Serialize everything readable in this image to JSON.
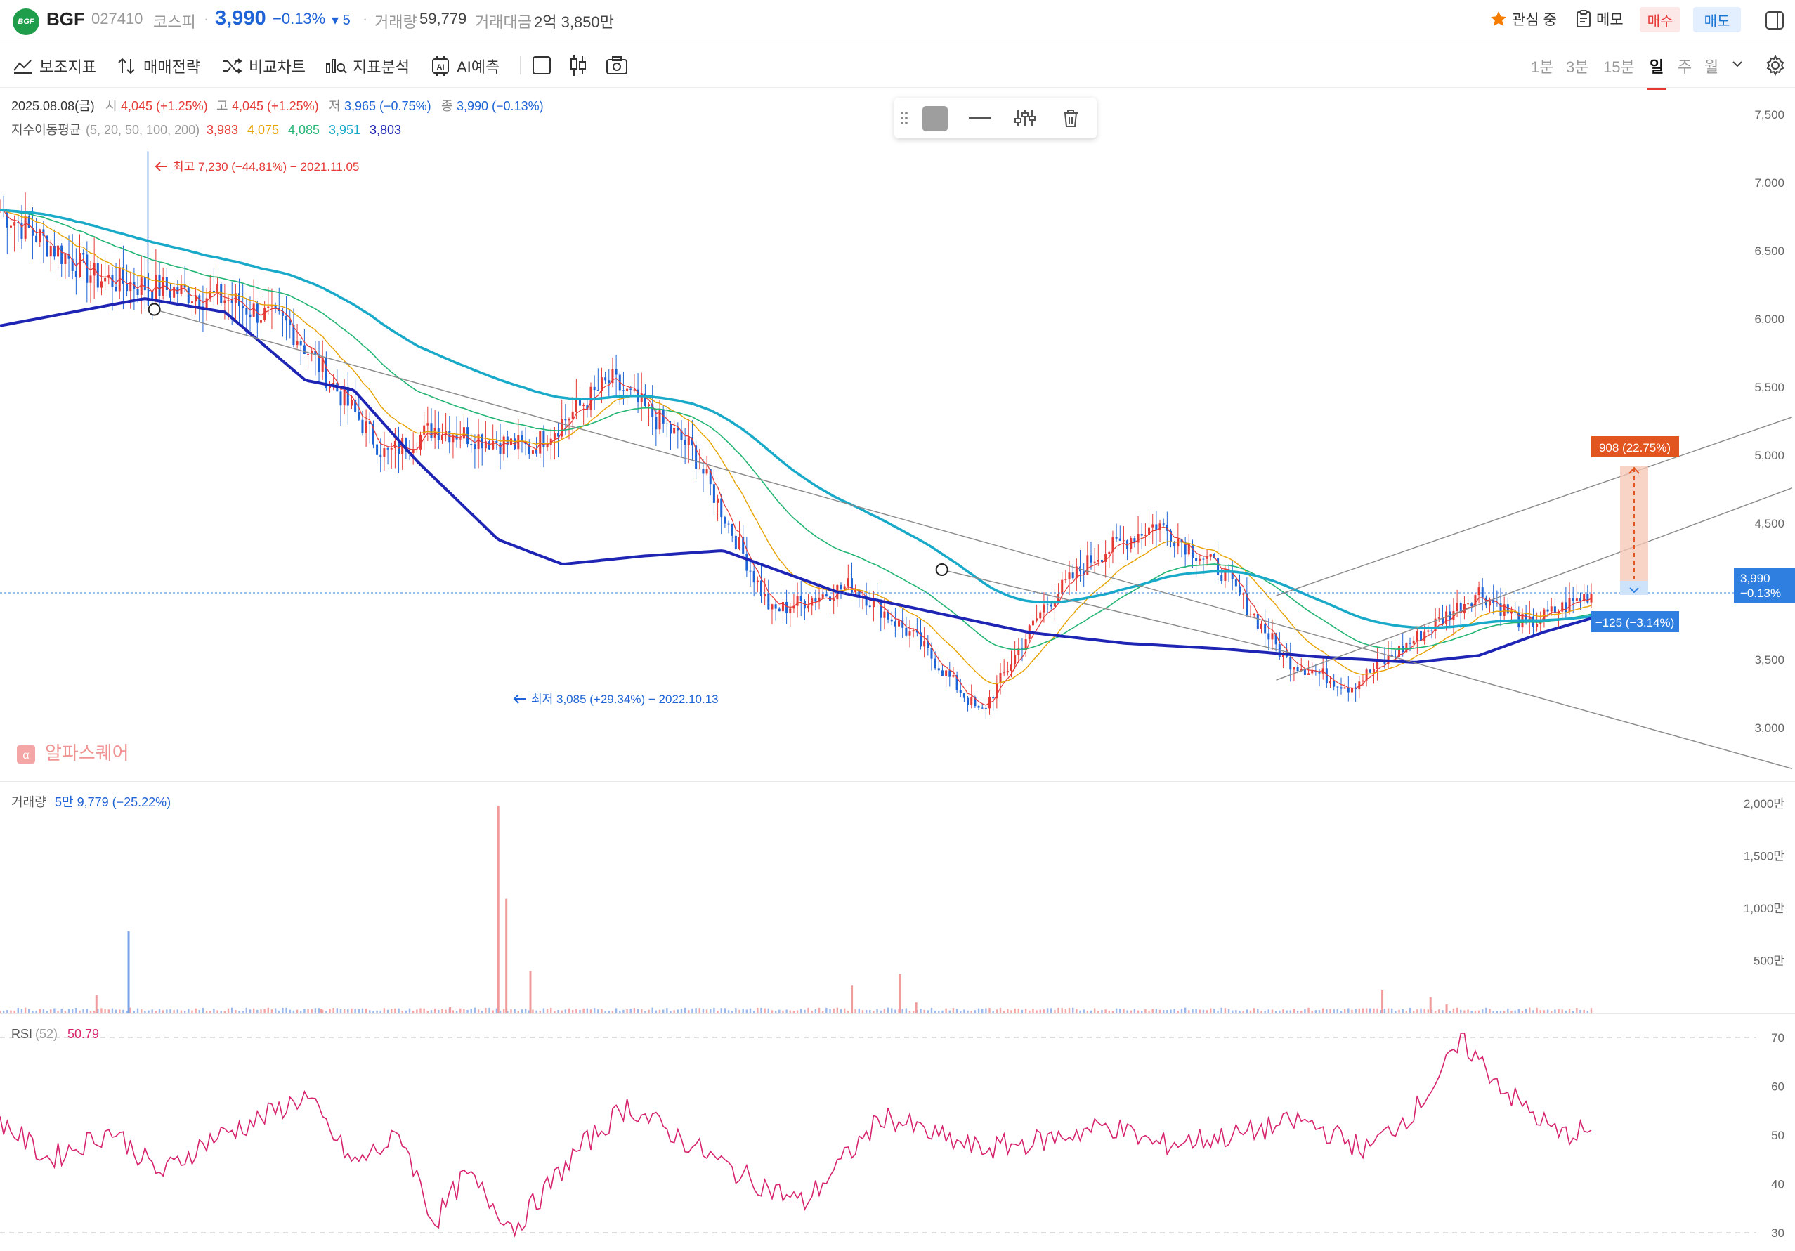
{
  "header": {
    "logo_text": "BGF",
    "name": "BGF",
    "code": "027410",
    "market": "코스피",
    "price": "3,990",
    "change_pct": "−0.13%",
    "change_abs": "▾ 5",
    "volume_label": "거래량",
    "volume": "59,779",
    "amount_label": "거래대금",
    "amount": "2억 3,850만",
    "watch_label": "관심 중",
    "memo_label": "메모",
    "buy_label": "매수",
    "sell_label": "매도"
  },
  "toolbar": {
    "items": [
      "보조지표",
      "매매전략",
      "비교차트",
      "지표분석",
      "AI예측"
    ],
    "timeframes": [
      "1분",
      "3분",
      "15분",
      "일",
      "주",
      "월"
    ],
    "active_timeframe": "일"
  },
  "info": {
    "date": "2025.08.08(금)",
    "open_label": "시",
    "open": "4,045 (+1.25%)",
    "high_label": "고",
    "high": "4,045 (+1.25%)",
    "low_label": "저",
    "low": "3,965 (−0.75%)",
    "close_label": "종",
    "close": "3,990 (−0.13%)",
    "ma_label": "지수이동평균",
    "ma_params": "(5, 20, 50, 100, 200)",
    "ma_values": [
      "3,983",
      "4,075",
      "4,085",
      "3,951",
      "3,803"
    ]
  },
  "annotations": {
    "high": "최고 7,230 (−44.81%) − 2021.11.05",
    "low": "최저 3,085 (+29.34%) − 2022.10.13",
    "measure_up": "908 (22.75%)",
    "measure_down": "−125 (−3.14%)",
    "price_tag_value": "3,990",
    "price_tag_change": "−0.13%",
    "watermark": "알파스퀘어"
  },
  "volume_panel": {
    "label": "거래량",
    "value": "5만 9,779 (−25.22%)"
  },
  "rsi_panel": {
    "label": "RSI",
    "param": "(52)",
    "value": "50.79"
  },
  "colors": {
    "up": "#e53935",
    "down": "#1e63d6",
    "ma5": "#e53935",
    "ma20": "#e8a200",
    "ma50": "#22b573",
    "ma100": "#19a9c9",
    "ma200": "#1e24b4",
    "rsi": "#d6246e",
    "tag_up": "#e25420",
    "tag_down": "#2f7fe0"
  },
  "chart_data": [
    {
      "type": "line",
      "title": "",
      "y_axis_ticks": [
        "7,500",
        "7,000",
        "6,500",
        "6,000",
        "5,500",
        "5,000",
        "4,500",
        "4,000",
        "3,500",
        "3,000"
      ],
      "ylim": [
        2650,
        7650
      ],
      "series": [
        {
          "name": "close",
          "x": [
            0,
            6,
            14,
            18,
            24,
            27,
            33,
            38,
            43,
            48,
            53,
            57,
            61,
            65,
            68,
            72,
            76,
            80,
            84,
            88,
            92,
            95,
            99
          ],
          "values": [
            6800,
            6300,
            6150,
            5950,
            5000,
            5200,
            5050,
            5550,
            5050,
            3850,
            4050,
            3650,
            3100,
            3900,
            4250,
            4500,
            4150,
            3500,
            3300,
            3650,
            4000,
            3750,
            3990
          ]
        },
        {
          "name": "MA200",
          "x": [
            0,
            9,
            14,
            19,
            22,
            26,
            31,
            35,
            40,
            45,
            52,
            58,
            64,
            70,
            76,
            82,
            88,
            92,
            96,
            99
          ],
          "values": [
            5950,
            6150,
            6050,
            5550,
            5480,
            4950,
            4380,
            4200,
            4260,
            4300,
            4000,
            3850,
            3700,
            3620,
            3580,
            3520,
            3480,
            3530,
            3700,
            3803
          ]
        }
      ]
    },
    {
      "type": "bar",
      "title": "",
      "y_axis_ticks": [
        "2,000만",
        "1,500만",
        "1,000만",
        "500만"
      ],
      "ylim": [
        0,
        20000000
      ],
      "x": [
        6,
        8,
        20,
        28,
        31,
        31.5,
        33,
        53,
        56,
        57,
        86,
        89,
        90
      ],
      "values": [
        1700000,
        7800000,
        400000,
        550000,
        19800000,
        10900000,
        4000000,
        2600000,
        3700000,
        1000000,
        2200000,
        1500000,
        800000
      ]
    },
    {
      "type": "line",
      "title": "",
      "y_axis_ticks": [
        "70",
        "60",
        "50",
        "40",
        "30"
      ],
      "ylim": [
        27,
        73
      ],
      "series": [
        {
          "name": "RSI",
          "x": [
            0,
            3,
            7,
            10,
            13,
            16,
            19,
            22,
            25,
            27,
            29,
            32,
            36,
            39,
            42,
            46,
            50,
            55,
            58,
            61,
            65,
            69,
            72,
            77,
            81,
            85,
            88,
            91,
            94,
            97,
            99
          ],
          "values": [
            53,
            45,
            51,
            42,
            49,
            53,
            58,
            44,
            50,
            32,
            42,
            31,
            47,
            56,
            50,
            42,
            36,
            54,
            50,
            47,
            49,
            52,
            48,
            50,
            53,
            47,
            55,
            69,
            58,
            50,
            51
          ]
        }
      ]
    }
  ]
}
